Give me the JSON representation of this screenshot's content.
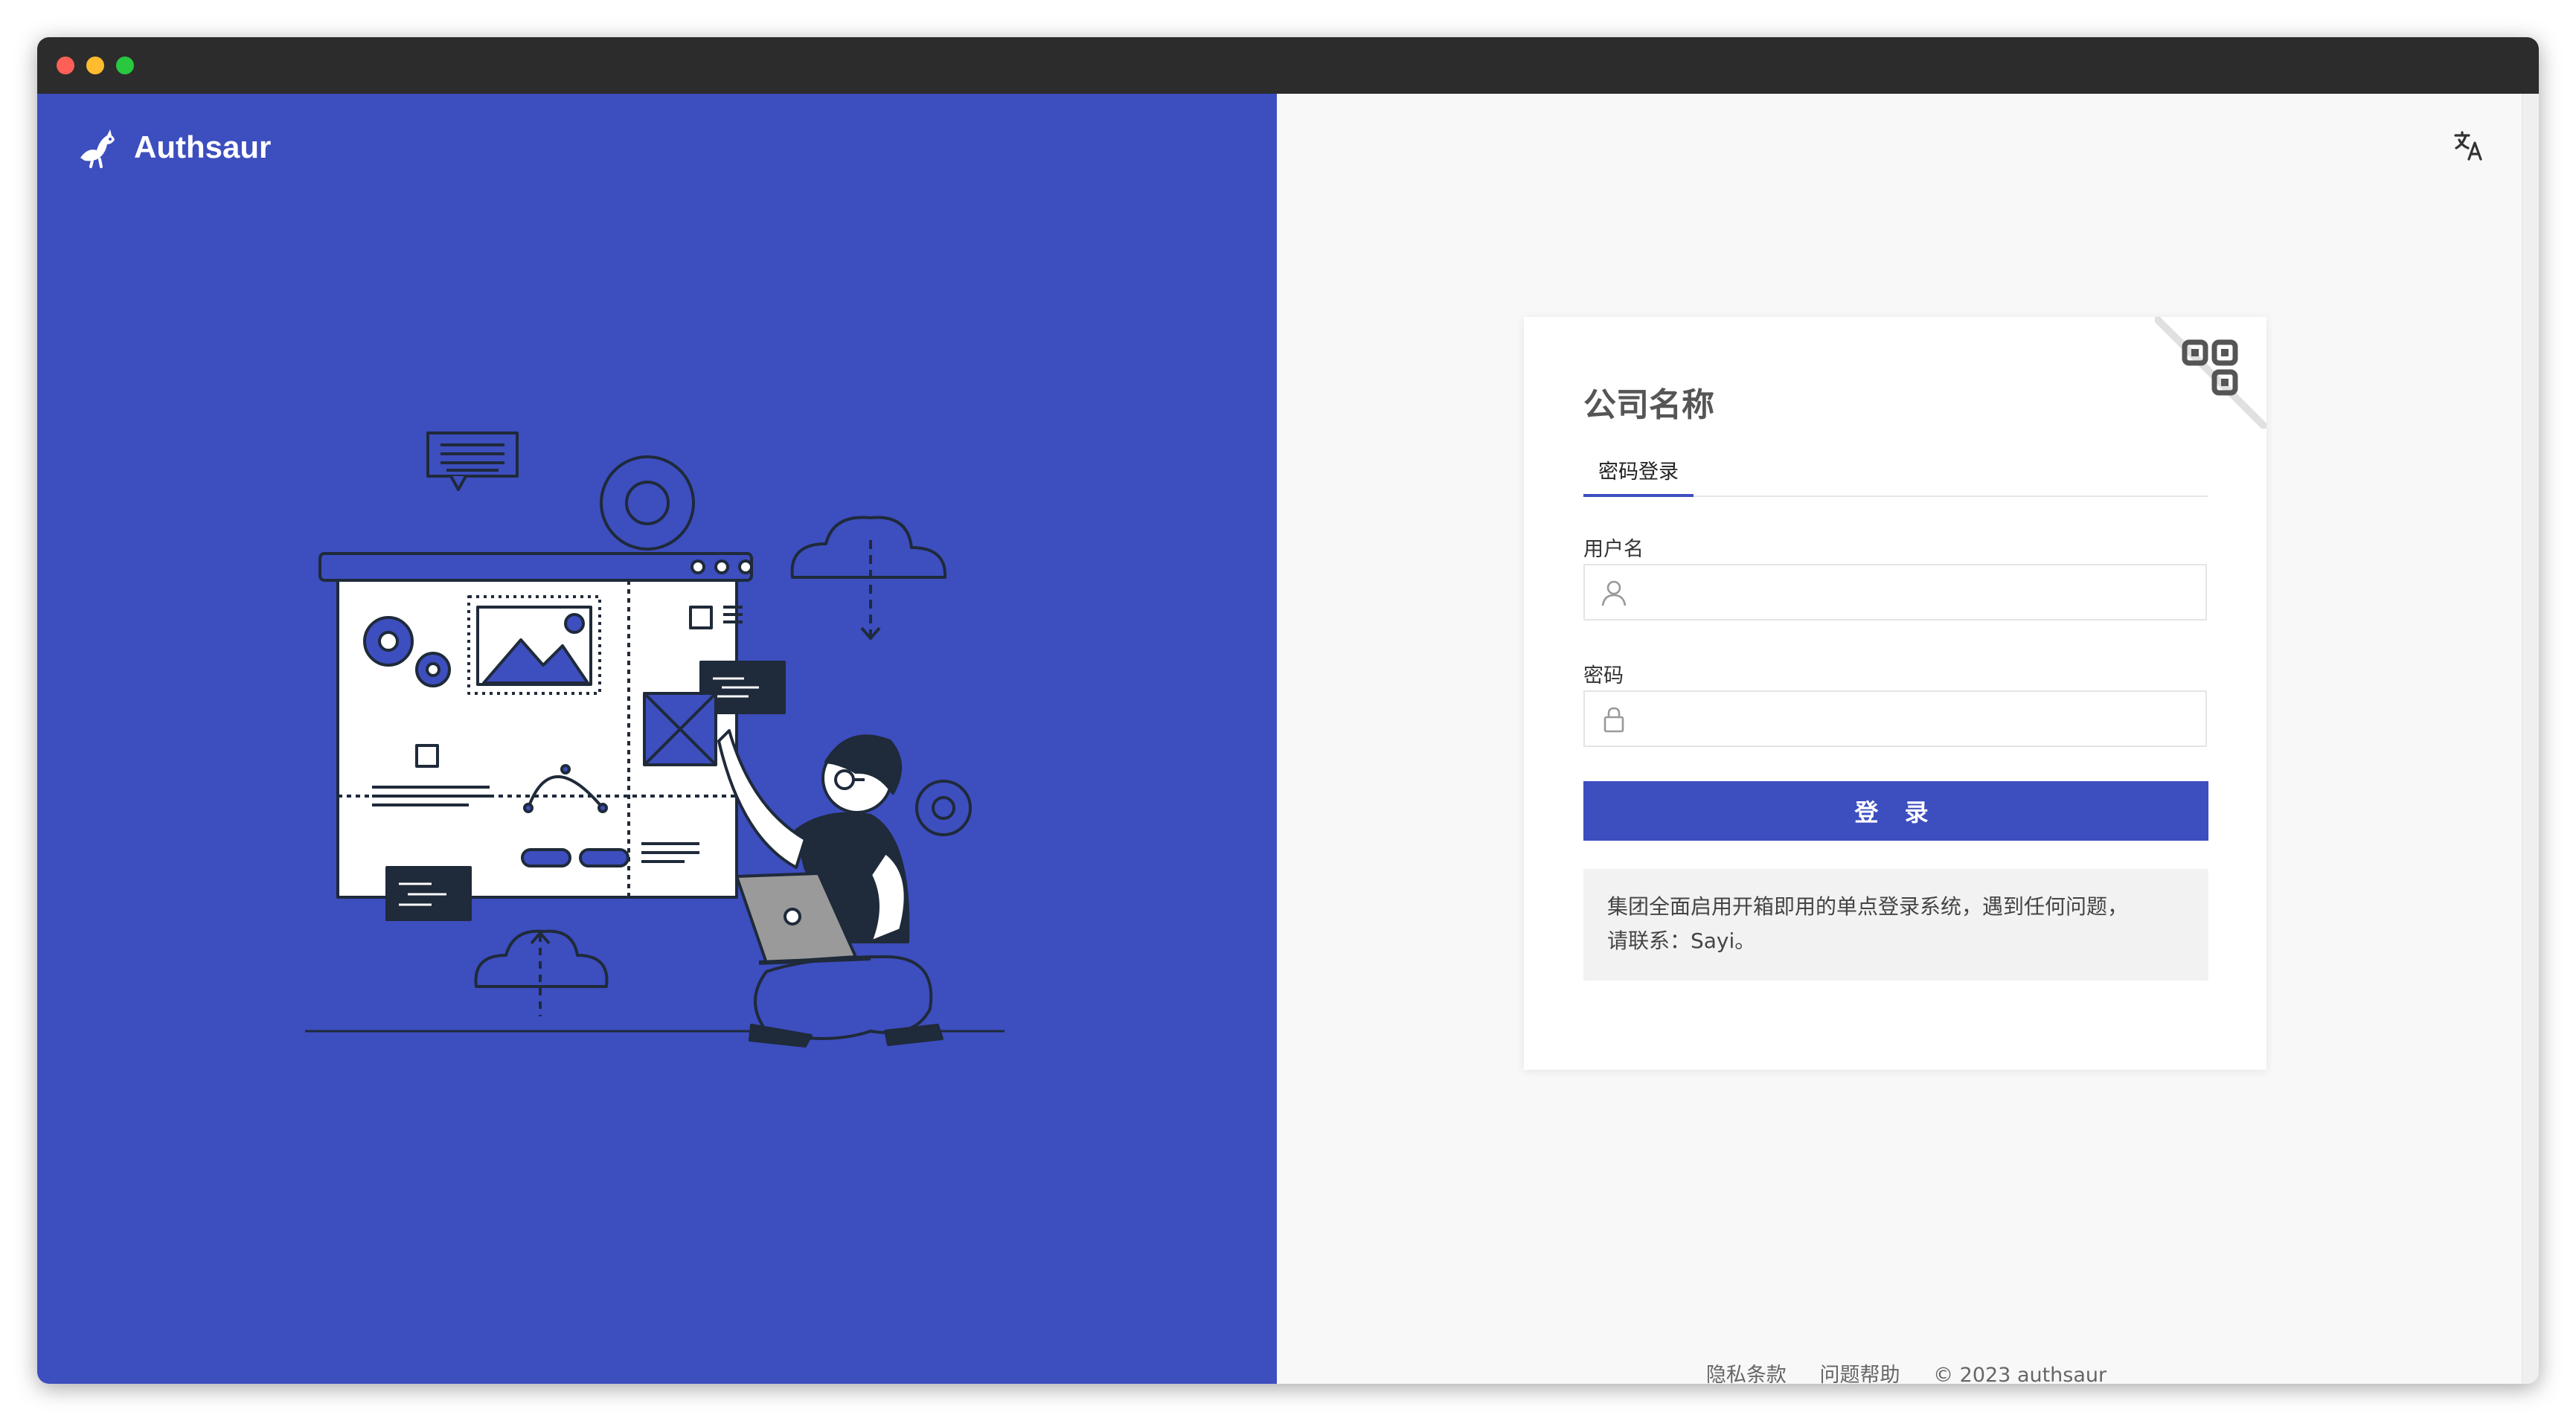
{
  "app": {
    "name": "Authsaur"
  },
  "window": {
    "controls": [
      "close",
      "minimize",
      "zoom"
    ]
  },
  "colors": {
    "brand": "#3d4ebf",
    "panel_background": "#f8f8f8",
    "card_background": "#ffffff"
  },
  "header": {
    "language_icon": "translate-icon"
  },
  "login": {
    "company_name": "公司名称",
    "tabs": [
      {
        "label": "密码登录",
        "active": true
      }
    ],
    "username": {
      "label": "用户名",
      "value": "",
      "placeholder": "",
      "icon": "user-icon"
    },
    "password": {
      "label": "密码",
      "value": "",
      "placeholder": "",
      "icon": "lock-icon"
    },
    "submit_label": "登 录",
    "notice_line1": "集团全面启用开箱即用的单点登录系统，遇到任何问题，",
    "notice_line2": "请联系：Sayi。",
    "qr_icon": "qr-code-icon"
  },
  "footer": {
    "privacy": "隐私条款",
    "help": "问题帮助",
    "copyright": "© 2023 authsaur"
  }
}
